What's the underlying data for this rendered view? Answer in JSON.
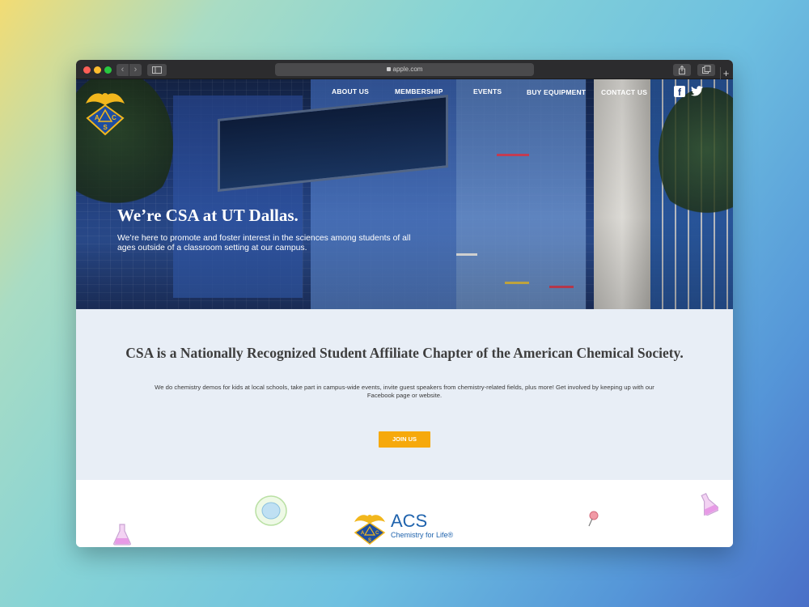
{
  "browser": {
    "url": "apple.com",
    "new_tab_label": "+"
  },
  "site": {
    "nav": [
      {
        "label": "ABOUT US"
      },
      {
        "label": "MEMBERSHIP"
      },
      {
        "label": "EVENTS"
      },
      {
        "label": "BUY EQUIPMENT"
      },
      {
        "label": "CONTACT US"
      }
    ],
    "logo_letters": {
      "a": "A",
      "c": "C",
      "s": "S"
    },
    "hero": {
      "title": "We’re CSA at UT Dallas.",
      "subtitle": "We’re here to promote and foster interest in the sciences among students of all ages outside of a classroom setting at our campus."
    },
    "about": {
      "title": "CSA is a Nationally Recognized Student Affiliate Chapter of the American Chemical Society.",
      "body": "We do chemistry demos for kids at local schools, take part in campus-wide events, invite guest speakers from chemistry-related fields, plus more! Get involved by keeping up with our Facebook page or website.",
      "button_label": "JOIN US"
    },
    "acs": {
      "wordmark": "ACS",
      "tagline": "Chemistry for Life®",
      "logo_letters": {
        "a": "A",
        "c": "C",
        "s": "S"
      }
    }
  },
  "colors": {
    "accent_orange": "#f6a90c",
    "acs_blue": "#1f63ad",
    "section_bg": "#e8eef6",
    "logo_gold": "#f2b71d"
  },
  "icons": [
    "back-arrow-icon",
    "forward-arrow-icon",
    "sidebar-icon",
    "lock-icon",
    "share-icon",
    "tabs-icon",
    "facebook-icon",
    "twitter-icon",
    "flask-icon",
    "petri-dish-icon",
    "pin-icon"
  ]
}
